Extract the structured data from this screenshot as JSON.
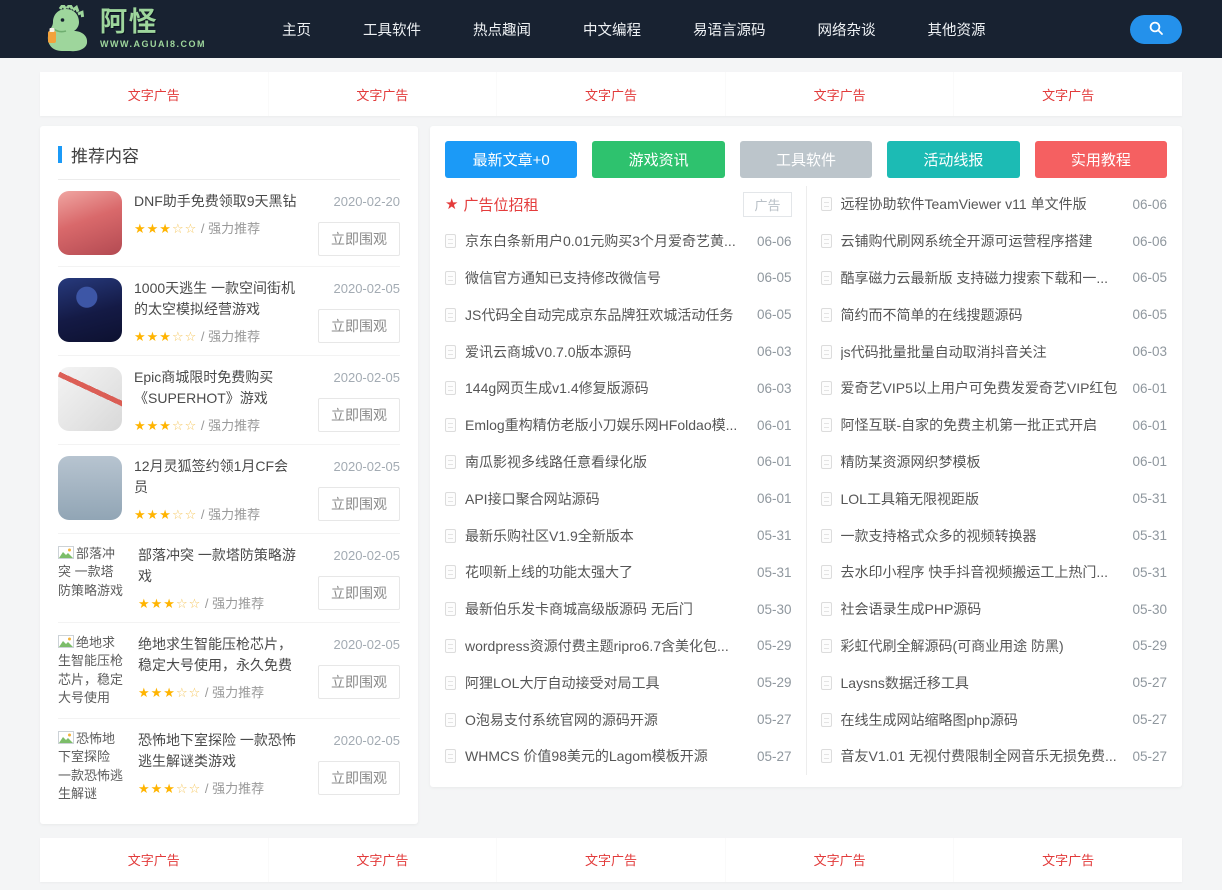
{
  "nav": {
    "brand": {
      "title": "阿怪",
      "subtitle": "WWW.AGUAI8.COM"
    },
    "items": [
      {
        "label": "主页"
      },
      {
        "label": "工具软件"
      },
      {
        "label": "热点趣闻"
      },
      {
        "label": "中文编程"
      },
      {
        "label": "易语言源码"
      },
      {
        "label": "网络杂谈"
      },
      {
        "label": "其他资源"
      }
    ],
    "bg_color": "#182231",
    "search_color": "#2491eb"
  },
  "ads": {
    "color": "#e23a3a",
    "top": [
      {
        "label": "文字广告"
      },
      {
        "label": "文字广告"
      },
      {
        "label": "文字广告"
      },
      {
        "label": "文字广告"
      },
      {
        "label": "文字广告"
      }
    ],
    "bottom": [
      {
        "label": "文字广告"
      },
      {
        "label": "文字广告"
      },
      {
        "label": "文字广告"
      },
      {
        "label": "文字广告"
      },
      {
        "label": "文字广告"
      }
    ]
  },
  "sidebar": {
    "title": "推荐内容",
    "accent_color": "#1b9af7",
    "items": [
      {
        "title": "DNF助手免费领取9天黑钻",
        "date": "2020-02-20",
        "stars": "★★★",
        "stars_empty": "☆☆",
        "rating_text": "/ 强力推荐",
        "button": "立即围观"
      },
      {
        "title": "1000天逃生 一款空间街机的太空模拟经营游戏",
        "date": "2020-02-05",
        "stars": "★★★",
        "stars_empty": "☆☆",
        "rating_text": "/ 强力推荐",
        "button": "立即围观"
      },
      {
        "title": "Epic商城限时免费购买《SUPERHOT》游戏",
        "date": "2020-02-05",
        "stars": "★★★",
        "stars_empty": "☆☆",
        "rating_text": "/ 强力推荐",
        "button": "立即围观"
      },
      {
        "title": "12月灵狐签约领1月CF会员",
        "date": "2020-02-05",
        "stars": "★★★",
        "stars_empty": "☆☆",
        "rating_text": "/ 强力推荐",
        "button": "立即围观"
      },
      {
        "title": "部落冲突 一款塔防策略游戏",
        "alt": "部落冲突 一款塔防策略游戏",
        "date": "2020-02-05",
        "stars": "★★★",
        "stars_empty": "☆☆",
        "rating_text": "/ 强力推荐",
        "button": "立即围观"
      },
      {
        "title": "绝地求生智能压枪芯片，稳定大号使用，永久免费",
        "alt": "绝地求生智能压枪芯片，稳定大号使用",
        "date": "2020-02-05",
        "stars": "★★★",
        "stars_empty": "☆☆",
        "rating_text": "/ 强力推荐",
        "button": "立即围观"
      },
      {
        "title": "恐怖地下室探险 一款恐怖逃生解谜类游戏",
        "alt": "恐怖地下室探险 一款恐怖逃生解谜",
        "date": "2020-02-05",
        "stars": "★★★",
        "stars_empty": "☆☆",
        "rating_text": "/ 强力推荐",
        "button": "立即围观"
      }
    ]
  },
  "main": {
    "category_buttons": [
      {
        "label": "最新文章+0",
        "color": "#1b9af7"
      },
      {
        "label": "游戏资讯",
        "color": "#2ec26e"
      },
      {
        "label": "工具软件",
        "color": "#bcc5cb"
      },
      {
        "label": "活动线报",
        "color": "#1cbbb4"
      },
      {
        "label": "实用教程",
        "color": "#f56061"
      }
    ],
    "left_list": {
      "header": {
        "icon": "★",
        "label": "广告位招租",
        "tag": "广告"
      },
      "items": [
        {
          "title": "京东白条新用户0.01元购买3个月爱奇艺黄...",
          "date": "06-06"
        },
        {
          "title": "微信官方通知已支持修改微信号",
          "date": "06-05"
        },
        {
          "title": "JS代码全自动完成京东品牌狂欢城活动任务",
          "date": "06-05"
        },
        {
          "title": "爱讯云商城V0.7.0版本源码",
          "date": "06-03"
        },
        {
          "title": "144g网页生成v1.4修复版源码",
          "date": "06-03"
        },
        {
          "title": "Emlog重构精仿老版小刀娱乐网HFoldao模...",
          "date": "06-01"
        },
        {
          "title": "南瓜影视多线路任意看绿化版",
          "date": "06-01"
        },
        {
          "title": "API接口聚合网站源码",
          "date": "06-01"
        },
        {
          "title": "最新乐购社区V1.9全新版本",
          "date": "05-31"
        },
        {
          "title": "花呗新上线的功能太强大了",
          "date": "05-31"
        },
        {
          "title": "最新伯乐发卡商城高级版源码 无后门",
          "date": "05-30"
        },
        {
          "title": "wordpress资源付费主题ripro6.7含美化包...",
          "date": "05-29"
        },
        {
          "title": "阿狸LOL大厅自动接受对局工具",
          "date": "05-29"
        },
        {
          "title": "O泡易支付系统官网的源码开源",
          "date": "05-27"
        },
        {
          "title": "WHMCS 价值98美元的Lagom模板开源",
          "date": "05-27"
        }
      ]
    },
    "right_list": {
      "items": [
        {
          "title": "远程协助软件TeamViewer v11 单文件版",
          "date": "06-06"
        },
        {
          "title": "云铺购代刷网系统全开源可运营程序搭建",
          "date": "06-06"
        },
        {
          "title": "酷享磁力云最新版 支持磁力搜索下载和一...",
          "date": "06-05"
        },
        {
          "title": "简约而不简单的在线搜题源码",
          "date": "06-05"
        },
        {
          "title": "js代码批量批量自动取消抖音关注",
          "date": "06-03"
        },
        {
          "title": "爱奇艺VIP5以上用户可免费发爱奇艺VIP红包",
          "date": "06-01"
        },
        {
          "title": "阿怪互联-自家的免费主机第一批正式开启",
          "date": "06-01"
        },
        {
          "title": "精防某资源网织梦模板",
          "date": "06-01"
        },
        {
          "title": "LOL工具箱无限视距版",
          "date": "05-31"
        },
        {
          "title": "一款支持格式众多的视频转换器",
          "date": "05-31"
        },
        {
          "title": "去水印小程序 快手抖音视频搬运工上热门...",
          "date": "05-31"
        },
        {
          "title": "社会语录生成PHP源码",
          "date": "05-30"
        },
        {
          "title": "彩虹代刷全解源码(可商业用途 防黑)",
          "date": "05-29"
        },
        {
          "title": "Laysns数据迁移工具",
          "date": "05-27"
        },
        {
          "title": "在线生成网站缩略图php源码",
          "date": "05-27"
        },
        {
          "title": "音友V1.01 无视付费限制全网音乐无损免费...",
          "date": "05-27"
        }
      ]
    }
  }
}
